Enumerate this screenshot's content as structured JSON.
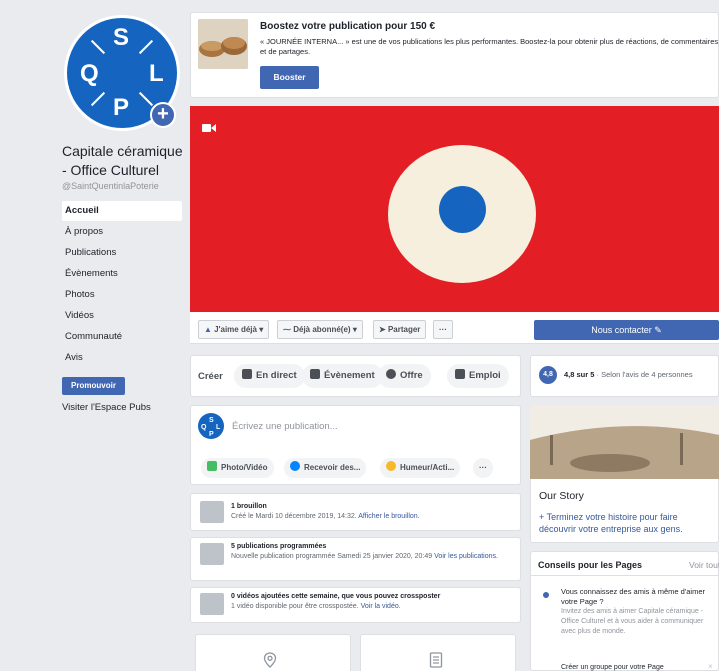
{
  "page": {
    "name": "Capitale céramique - Office Culturel",
    "handle": "@SaintQuentinlaPoterie",
    "logo_letters": {
      "top": "S",
      "left": "Q",
      "right": "L",
      "bottom": "P"
    }
  },
  "nav": {
    "items": [
      "Accueil",
      "À propos",
      "Publications",
      "Évènements",
      "Photos",
      "Vidéos",
      "Communauté",
      "Avis"
    ],
    "promote_label": "Promouvoir",
    "ads_link": "Visiter l'Espace Pubs"
  },
  "boost": {
    "title": "Boostez votre publication pour 150 €",
    "text": "« JOURNÉE INTERNA... » est une de vos publications les plus performantes. Boostez-la pour obtenir plus de réactions, de commentaires et de partages.",
    "button": "Booster"
  },
  "actions": {
    "like": "J'aime déjà",
    "follow": "Déjà abonné(e)",
    "share": "Partager",
    "more": "···",
    "contact": "Nous contacter"
  },
  "create": {
    "label": "Créer",
    "options": [
      "En direct",
      "Évènement",
      "Offre",
      "Emploi"
    ]
  },
  "composer": {
    "placeholder": "Écrivez une publication...",
    "options": [
      "Photo/Vidéo",
      "Recevoir des...",
      "Humeur/Acti...",
      "···"
    ]
  },
  "activity": {
    "draft": {
      "title": "1 brouillon",
      "text": "Créé le Mardi 10 décembre 2019, 14:32.",
      "link": "Afficher le brouillon."
    },
    "scheduled": {
      "title": "5 publications programmées",
      "text": "Nouvelle publication programmée Samedi 25 janvier 2020, 20:49",
      "link": "Voir les publications."
    },
    "crosspost": {
      "title": "0 vidéos ajoutées cette semaine, que vous pouvez crossposter",
      "text": "1 vidéo disponible pour être crosspostée.",
      "link": "Voir la vidéo."
    }
  },
  "rating": {
    "score": "4,8",
    "bold": "4,8 sur 5",
    "text": " · Selon l'avis de 4 personnes"
  },
  "story": {
    "title": "Our Story",
    "link": "+ Terminez votre histoire pour faire découvrir votre entreprise aux gens."
  },
  "tips": {
    "title": "Conseils pour les Pages",
    "see_all": "Voir tout",
    "tip_title": "Vous connaissez des amis à même d'aimer votre Page ?",
    "tip_text": "Invitez des amis à aimer Capitale céramique - Office Culturel et à vous aider à communiquer avec plus de monde.",
    "tip2": "Créer un groupe pour votre Page",
    "close": "×"
  },
  "colors": {
    "brand_blue": "#4267b2",
    "logo_blue": "#1565c0",
    "cover_red": "#e31e24"
  }
}
